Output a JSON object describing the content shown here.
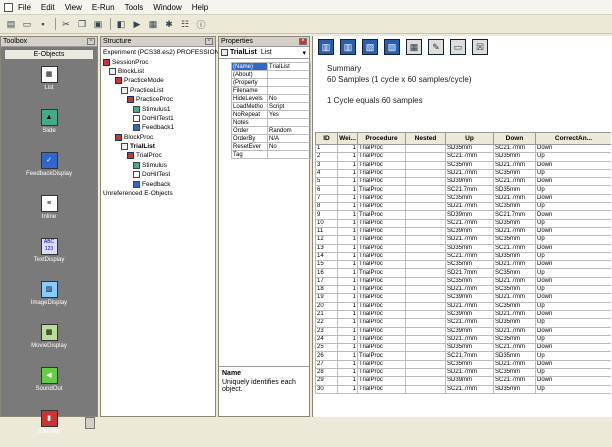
{
  "menu": [
    "File",
    "Edit",
    "View",
    "E-Run",
    "Tools",
    "Window",
    "Help"
  ],
  "toolbox": {
    "title": "Toolbox",
    "tab": "E-Objects",
    "tools": [
      "List",
      "Slide",
      "FeedbackDisplay",
      "Inline",
      "TextDisplay",
      "ImageDisplay",
      "MovieDisplay",
      "SoundOut",
      "SoundIn"
    ],
    "text_icon_label": "ABC\n123"
  },
  "structure": {
    "title": "Structure",
    "nodes": [
      {
        "label": "Experiment (PCS38.es2) PROFESSIONAL",
        "level": 0,
        "icon": "none"
      },
      {
        "label": "SessionProc",
        "level": 0,
        "icon": "proc"
      },
      {
        "label": "BlockList",
        "level": 1,
        "icon": "list"
      },
      {
        "label": "PracticeMode",
        "level": 2,
        "icon": "proc"
      },
      {
        "label": "PracticeList",
        "level": 3,
        "icon": "list"
      },
      {
        "label": "PracticeProc",
        "level": 4,
        "icon": "proc"
      },
      {
        "label": "Stimulus1",
        "level": 5,
        "icon": "slide"
      },
      {
        "label": "DoHitTest1",
        "level": 5,
        "icon": "text"
      },
      {
        "label": "Feedback1",
        "level": 5,
        "icon": "feed"
      },
      {
        "label": "BlockProc",
        "level": 2,
        "icon": "proc"
      },
      {
        "label": "TrialList",
        "level": 3,
        "icon": "list",
        "bold": true
      },
      {
        "label": "TrialProc",
        "level": 4,
        "icon": "proc"
      },
      {
        "label": "Stimulus",
        "level": 5,
        "icon": "slide"
      },
      {
        "label": "DoHitTest",
        "level": 5,
        "icon": "text"
      },
      {
        "label": "Feedback",
        "level": 5,
        "icon": "feed"
      },
      {
        "label": "Unreferenced E-Objects",
        "level": 0,
        "icon": "none"
      }
    ]
  },
  "properties": {
    "title": "Properties",
    "object": "TrialList",
    "type": "List",
    "rows": [
      [
        "(Name)",
        "TrialList"
      ],
      [
        "(About)",
        ""
      ],
      [
        "(Property",
        ""
      ],
      [
        "Filename",
        ""
      ],
      [
        "HideLevels",
        "No"
      ],
      [
        "LoadMetho",
        "Script"
      ],
      [
        "NoRepeat",
        "Yes"
      ],
      [
        "Notes",
        ""
      ],
      [
        "Order",
        "Random"
      ],
      [
        "OrderBy",
        "N/A"
      ],
      [
        "ResetEver",
        "No"
      ],
      [
        "Tag",
        ""
      ]
    ],
    "desc_title": "Name",
    "desc_text": "Uniquely identifies each object."
  },
  "summary": {
    "heading": "Summary",
    "line1": "60 Samples (1 cycle x 60 samples/cycle)",
    "line2": "1 Cycle equals 60 samples"
  },
  "grid": {
    "columns": [
      "ID",
      "Wei...",
      "Procedure",
      "Nested",
      "Up",
      "Down",
      "CorrectAn..."
    ],
    "rows": [
      [
        "1",
        "1",
        "TrialProc",
        "",
        "SD35mm",
        "SC21.7mm",
        "Down"
      ],
      [
        "2",
        "1",
        "TrialProc",
        "",
        "SC21.7mm",
        "SD35mm",
        "Up"
      ],
      [
        "3",
        "1",
        "TrialProc",
        "",
        "SC35mm",
        "SD21.7mm",
        "Down"
      ],
      [
        "4",
        "1",
        "TrialProc",
        "",
        "SD21.7mm",
        "SC35mm",
        "Up"
      ],
      [
        "5",
        "1",
        "TrialProc",
        "",
        "SD39mm",
        "SC21.7mm",
        "Down"
      ],
      [
        "6",
        "1",
        "TrialProc",
        "",
        "SC21.7mm",
        "SD35mm",
        "Up"
      ],
      [
        "7",
        "1",
        "TrialProc",
        "",
        "SC35mm",
        "SD21.7mm",
        "Down"
      ],
      [
        "8",
        "1",
        "TrialProc",
        "",
        "SD21.7mm",
        "SC35mm",
        "Up"
      ],
      [
        "9",
        "1",
        "TrialProc",
        "",
        "SD39mm",
        "SC21.7mm",
        "Down"
      ],
      [
        "10",
        "1",
        "TrialProc",
        "",
        "SC21.7mm",
        "SD35mm",
        "Up"
      ],
      [
        "11",
        "1",
        "TrialProc",
        "",
        "SC39mm",
        "SD21.7mm",
        "Down"
      ],
      [
        "12",
        "1",
        "TrialProc",
        "",
        "SD21.7mm",
        "SC35mm",
        "Up"
      ],
      [
        "13",
        "1",
        "TrialProc",
        "",
        "SD35mm",
        "SC21.7mm",
        "Down"
      ],
      [
        "14",
        "1",
        "TrialProc",
        "",
        "SC21.7mm",
        "SD35mm",
        "Up"
      ],
      [
        "15",
        "1",
        "TrialProc",
        "",
        "SC35mm",
        "SD21.7mm",
        "Down"
      ],
      [
        "16",
        "1",
        "TrialProc",
        "",
        "SD21.7mm",
        "SC35mm",
        "Up"
      ],
      [
        "17",
        "1",
        "TrialProc",
        "",
        "SC35mm",
        "SD21.7mm",
        "Down"
      ],
      [
        "18",
        "1",
        "TrialProc",
        "",
        "SD21.7mm",
        "SC35mm",
        "Up"
      ],
      [
        "19",
        "1",
        "TrialProc",
        "",
        "SC39mm",
        "SD21.7mm",
        "Down"
      ],
      [
        "20",
        "1",
        "TrialProc",
        "",
        "SD21.7mm",
        "SC35mm",
        "Up"
      ],
      [
        "21",
        "1",
        "TrialProc",
        "",
        "SC39mm",
        "SD21.7mm",
        "Down"
      ],
      [
        "22",
        "1",
        "TrialProc",
        "",
        "SC21.7mm",
        "SD35mm",
        "Up"
      ],
      [
        "23",
        "1",
        "TrialProc",
        "",
        "SC39mm",
        "SD21.7mm",
        "Down"
      ],
      [
        "24",
        "1",
        "TrialProc",
        "",
        "SD21.7mm",
        "SC35mm",
        "Up"
      ],
      [
        "25",
        "1",
        "TrialProc",
        "",
        "SD35mm",
        "SC21.7mm",
        "Down"
      ],
      [
        "26",
        "1",
        "TrialProc",
        "",
        "SC21.7mm",
        "SD35mm",
        "Up"
      ],
      [
        "27",
        "1",
        "TrialProc",
        "",
        "SC35mm",
        "SD21.7mm",
        "Down"
      ],
      [
        "28",
        "1",
        "TrialProc",
        "",
        "SD21.7mm",
        "SC35mm",
        "Up"
      ],
      [
        "29",
        "1",
        "TrialProc",
        "",
        "SD39mm",
        "SC21.7mm",
        "Down"
      ],
      [
        "30",
        "1",
        "TrialProc",
        "",
        "SC21.7mm",
        "SD35mm",
        "Up"
      ]
    ]
  }
}
